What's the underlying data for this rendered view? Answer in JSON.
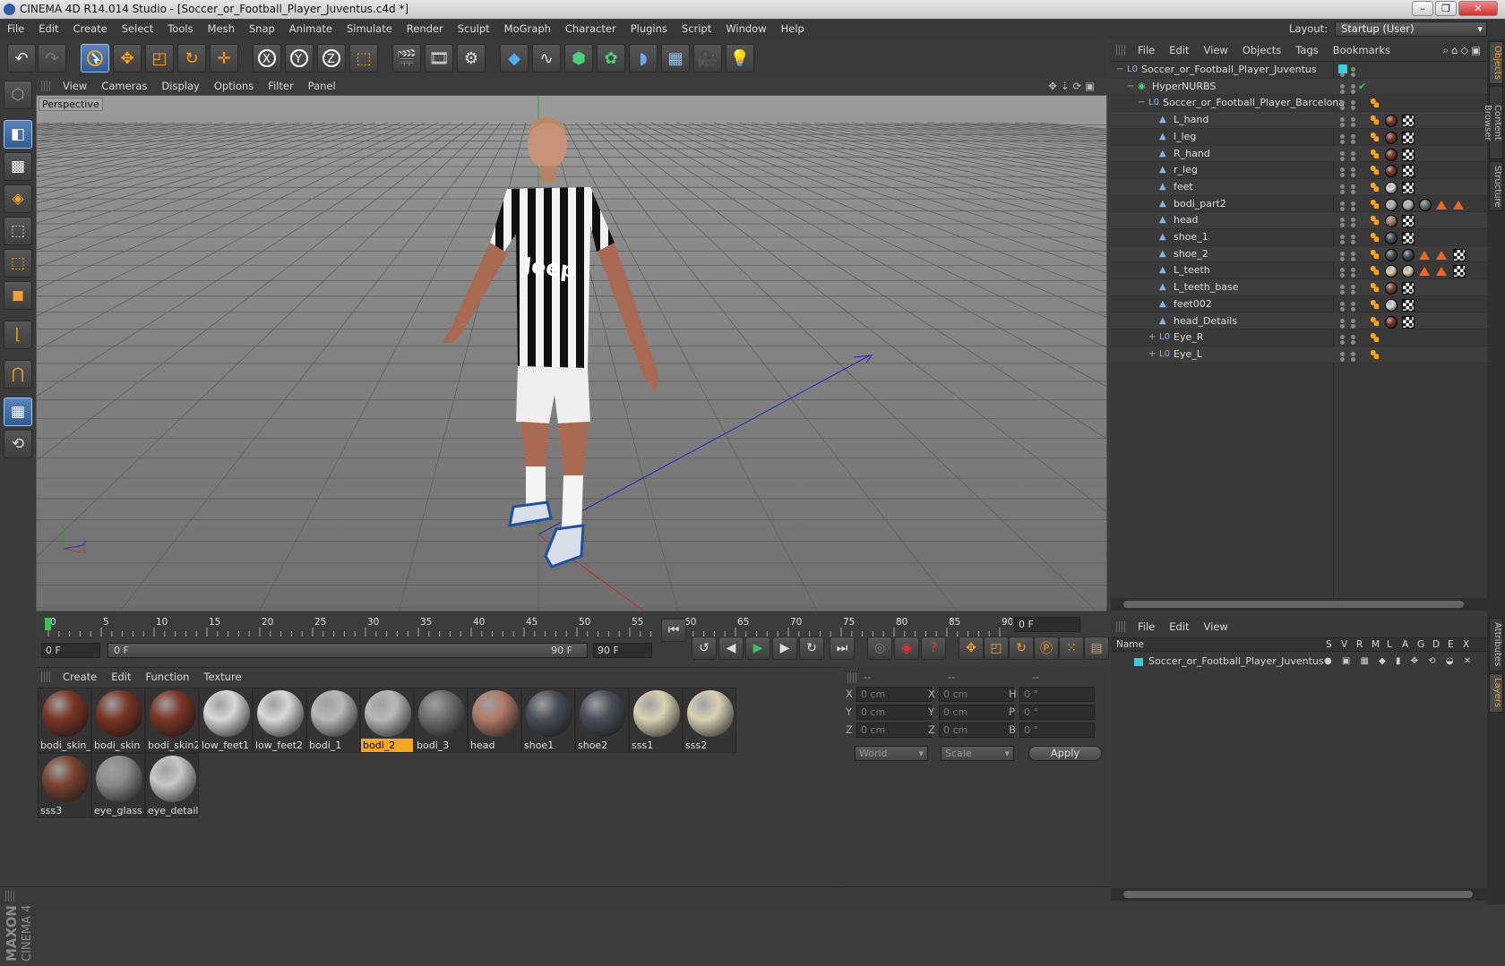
{
  "window": {
    "title": "CINEMA 4D R14.014 Studio - [Soccer_or_Football_Player_Juventus.c4d *]",
    "minimize": "–",
    "restore": "❐",
    "close": "✕"
  },
  "menu": [
    "File",
    "Edit",
    "Create",
    "Select",
    "Tools",
    "Mesh",
    "Snap",
    "Animate",
    "Simulate",
    "Render",
    "Sculpt",
    "MoGraph",
    "Character",
    "Plugins",
    "Script",
    "Window",
    "Help"
  ],
  "layout": {
    "label": "Layout:",
    "value": "Startup (User)"
  },
  "viewport": {
    "menu": [
      "View",
      "Cameras",
      "Display",
      "Options",
      "Filter",
      "Panel"
    ],
    "label": "Perspective"
  },
  "timeline": {
    "ticks": [
      "0",
      "5",
      "10",
      "15",
      "20",
      "25",
      "30",
      "35",
      "40",
      "45",
      "50",
      "55",
      "60",
      "65",
      "70",
      "75",
      "80",
      "85",
      "90"
    ],
    "current_frame": "0 F",
    "start": "0 F",
    "range_start": "0 F",
    "range_end": "90 F",
    "end": "90 F"
  },
  "materials": {
    "menu": [
      "Create",
      "Edit",
      "Function",
      "Texture"
    ],
    "items": [
      {
        "name": "bodi_skin_",
        "color": "#7a3524"
      },
      {
        "name": "bodi_skin",
        "color": "#7a3524"
      },
      {
        "name": "bodi_skin2",
        "color": "#7a3524"
      },
      {
        "name": "low_feet1",
        "color": "#d8d8d8"
      },
      {
        "name": "low_feet2",
        "color": "#d8d8d8"
      },
      {
        "name": "bodi_1",
        "color": "#b8b8b8"
      },
      {
        "name": "bodi_2",
        "color": "#b8b8b8",
        "selected": true
      },
      {
        "name": "bodi_3",
        "color": "#6e6e6e"
      },
      {
        "name": "head",
        "color": "#b07a66"
      },
      {
        "name": "shoe1",
        "color": "#4a4f58"
      },
      {
        "name": "shoe2",
        "color": "#4a4f58"
      },
      {
        "name": "sss1",
        "color": "#d8d3b4"
      },
      {
        "name": "sss2",
        "color": "#d8d3b4"
      },
      {
        "name": "sss3",
        "color": "#7a4530"
      },
      {
        "name": "eye_glass",
        "color": "#8a8a8a"
      },
      {
        "name": "eye_details",
        "color": "#c8c8c8"
      }
    ]
  },
  "attributes": {
    "header": [
      "--",
      "--",
      "--"
    ],
    "rows": [
      {
        "l1": "X",
        "v1": "0 cm",
        "l2": "X",
        "v2": "0 cm",
        "l3": "H",
        "v3": "0 °"
      },
      {
        "l1": "Y",
        "v1": "0 cm",
        "l2": "Y",
        "v2": "0 cm",
        "l3": "P",
        "v3": "0 °"
      },
      {
        "l1": "Z",
        "v1": "0 cm",
        "l2": "Z",
        "v2": "0 cm",
        "l3": "B",
        "v3": "0 °"
      }
    ],
    "coord_mode": "World",
    "size_mode": "Scale",
    "apply": "Apply"
  },
  "objects": {
    "menu": [
      "File",
      "Edit",
      "View",
      "Objects",
      "Tags",
      "Bookmarks"
    ],
    "rows": [
      {
        "name": "Soccer_or_Football_Player_Juventus",
        "indent": 0,
        "type": "null",
        "expand": "−"
      },
      {
        "name": "HyperNURBS",
        "indent": 1,
        "type": "nurbs",
        "expand": "−"
      },
      {
        "name": "Soccer_or_Football_Player_Barcelona",
        "indent": 2,
        "type": "null",
        "expand": "−"
      },
      {
        "name": "L_hand",
        "indent": 3,
        "type": "poly",
        "tags": [
          "#7a3524",
          "chk"
        ]
      },
      {
        "name": "l_leg",
        "indent": 3,
        "type": "poly",
        "tags": [
          "#7a3524",
          "chk"
        ]
      },
      {
        "name": "R_hand",
        "indent": 3,
        "type": "poly",
        "tags": [
          "#7a3524",
          "chk"
        ]
      },
      {
        "name": "r_leg",
        "indent": 3,
        "type": "poly",
        "tags": [
          "#7a3524",
          "chk"
        ]
      },
      {
        "name": "feet",
        "indent": 3,
        "type": "poly",
        "tags": [
          "#d8d8d8",
          "chk"
        ]
      },
      {
        "name": "bodi_part2",
        "indent": 3,
        "type": "poly",
        "tags": [
          "#b8b8b8",
          "#b8b8b8",
          "#6e6e6e",
          "tri",
          "tri"
        ]
      },
      {
        "name": "head",
        "indent": 3,
        "type": "poly",
        "tags": [
          "#b07a66",
          "chk"
        ]
      },
      {
        "name": "shoe_1",
        "indent": 3,
        "type": "poly",
        "tags": [
          "#4a4f58",
          "chk"
        ]
      },
      {
        "name": "shoe_2",
        "indent": 3,
        "type": "poly",
        "tags": [
          "#4a4f58",
          "#4a4f58",
          "tri",
          "tri",
          "chk"
        ]
      },
      {
        "name": "L_teeth",
        "indent": 3,
        "type": "poly",
        "tags": [
          "#d8d3b4",
          "#d8d3b4",
          "tri",
          "tri",
          "chk"
        ]
      },
      {
        "name": "L_teeth_base",
        "indent": 3,
        "type": "poly",
        "tags": [
          "#7a4530",
          "chk"
        ]
      },
      {
        "name": "feet002",
        "indent": 3,
        "type": "poly",
        "tags": [
          "#d8d8d8",
          "chk"
        ]
      },
      {
        "name": "head_Details",
        "indent": 3,
        "type": "poly",
        "tags": [
          "#7a3524",
          "chk"
        ]
      },
      {
        "name": "Eye_R",
        "indent": 3,
        "type": "null",
        "expand": "+"
      },
      {
        "name": "Eye_L",
        "indent": 3,
        "type": "null",
        "expand": "+"
      }
    ]
  },
  "layers": {
    "menu": [
      "File",
      "Edit",
      "View"
    ],
    "col_name": "Name",
    "cols": [
      "S",
      "V",
      "R",
      "M",
      "L",
      "A",
      "G",
      "D",
      "E",
      "X"
    ],
    "row": "Soccer_or_Football_Player_Juventus"
  },
  "side_tabs": [
    "Objects",
    "Content Browser",
    "Structure",
    "Attributes",
    "Layers"
  ],
  "brand": {
    "maxon": "MAXON",
    "product": "CINEMA 4D"
  }
}
